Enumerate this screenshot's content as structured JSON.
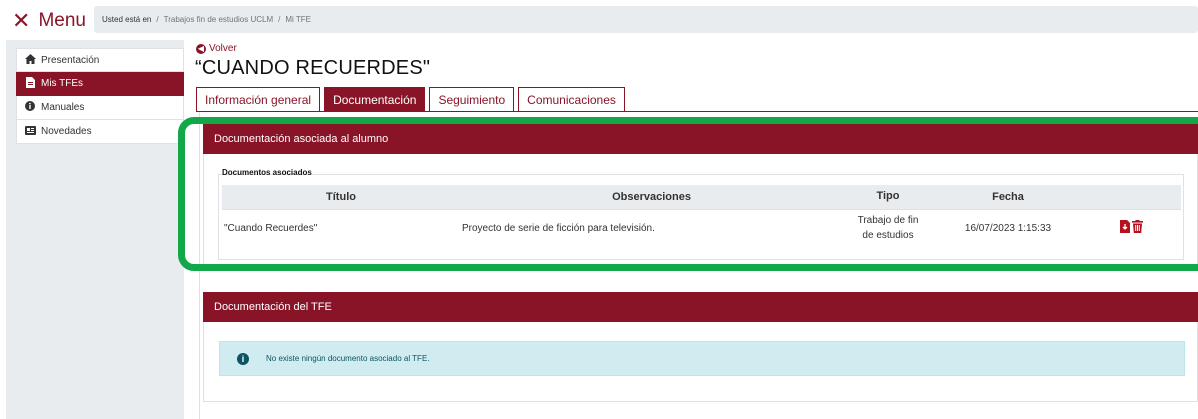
{
  "topbar": {
    "menu_label": "Menu",
    "breadcrumb_prefix": "Usted está en",
    "breadcrumb_items": [
      "Trabajos fin de estudios UCLM",
      "Mi TFE"
    ]
  },
  "sidebar": {
    "items": [
      {
        "label": "Presentación",
        "icon": "home-icon"
      },
      {
        "label": "Mis TFEs",
        "icon": "document-icon"
      },
      {
        "label": "Manuales",
        "icon": "info-icon"
      },
      {
        "label": "Novedades",
        "icon": "newspaper-icon"
      }
    ],
    "active_index": 1
  },
  "main": {
    "back_label": "Volver",
    "title": "“CUANDO RECUERDES\"",
    "tabs": [
      "Información general",
      "Documentación",
      "Seguimiento",
      "Comunicaciones"
    ],
    "active_tab": 1
  },
  "doc_alumno": {
    "heading": "Documentación asociada al alumno",
    "legend": "Documentos asociados",
    "columns": [
      "Título",
      "Observaciones",
      "Tipo",
      "Fecha",
      ""
    ],
    "rows": [
      {
        "titulo": "\"Cuando Recuerdes\"",
        "observaciones": "Proyecto de serie de ficción para televisión.",
        "tipo_line1": "Trabajo de fin",
        "tipo_line2": "de estudios",
        "fecha": "16/07/2023 1:15:33"
      }
    ]
  },
  "doc_tfe": {
    "heading": "Documentación del TFE",
    "info_message": "No existe ningún documento asociado al TFE."
  },
  "colors": {
    "brand": "#8a1427",
    "highlight": "#12a84a",
    "info_bg": "#d1ecf1"
  }
}
